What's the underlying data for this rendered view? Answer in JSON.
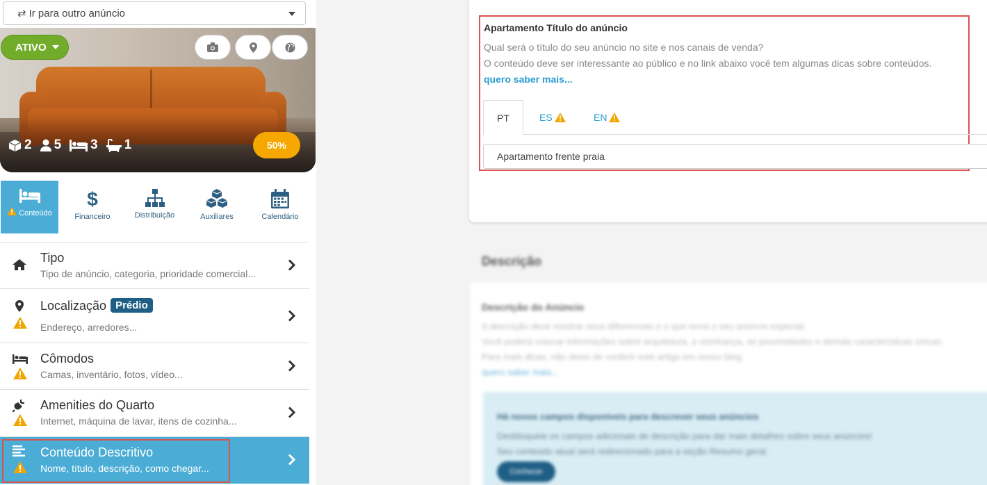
{
  "listing_selector": {
    "label": "Ir para outro anúncio"
  },
  "hero": {
    "status_label": "ATIVO",
    "stats": {
      "cubes": "2",
      "guests": "5",
      "beds": "3",
      "baths": "1"
    },
    "completion": "50%"
  },
  "main_tabs": [
    {
      "label": "Conteúdo",
      "icon": "bed-icon",
      "active": true,
      "warning": true
    },
    {
      "label": "Financeiro",
      "icon": "dollar-icon",
      "active": false
    },
    {
      "label": "Distribuição",
      "icon": "sitemap-icon",
      "active": false
    },
    {
      "label": "Auxiliares",
      "icon": "cubes-icon",
      "active": false
    },
    {
      "label": "Calendário",
      "icon": "calendar-icon",
      "active": false
    }
  ],
  "menu": [
    {
      "title": "Tipo",
      "subtitle": "Tipo de anúncio, categoria, prioridade comercial...",
      "icon": "home-icon",
      "warning": false
    },
    {
      "title": "Localização",
      "badge": "Prédio",
      "subtitle": "Endereço, arredores...",
      "icon": "map-marker-icon",
      "warning": true
    },
    {
      "title": "Cômodos",
      "subtitle": "Camas, inventário, fotos, vídeo...",
      "icon": "bed-icon",
      "warning": true
    },
    {
      "title": "Amenities do Quarto",
      "subtitle": "Internet, máquina de lavar, itens de cozinha...",
      "icon": "plug-icon",
      "warning": true
    },
    {
      "title": "Conteúdo Descritivo",
      "subtitle": "Nome, título, descrição, como chegar...",
      "icon": "align-left-icon",
      "warning": true,
      "active": true
    }
  ],
  "title_field": {
    "label": "Apartamento Título do anúncio",
    "help_line1": "Qual será o título do seu anúncio no site e nos canais de venda?",
    "help_line2": "O conteúdo deve ser interessante ao público e no link abaixo você tem algumas dicas sobre conteúdos.",
    "link": "quero saber mais...",
    "lang_tabs": [
      {
        "label": "PT",
        "active": true,
        "warning": false
      },
      {
        "label": "ES",
        "active": false,
        "warning": true
      },
      {
        "label": "EN",
        "active": false,
        "warning": true
      }
    ],
    "value": "Apartamento frente praia"
  },
  "description_section": {
    "heading": "Descrição",
    "field_label": "Descrição do Anúncio",
    "help_line1": "A descrição deve mostrar seus diferenciais e o que torna o seu anúncio especial.",
    "help_line2": "Você poderá colocar informações sobre arquitetura, a vizinhança, as proximidades e demais características únicas.",
    "help_line3": "Para mais dicas, não deixe de conferir este artigo em nosso blog.",
    "link": "quero saber mais...",
    "info_title": "Há novos campos disponíveis para descrever seus anúncios",
    "info_line1": "Desbloqueie os campos adicionais de descrição para dar mais detalhes sobre seus anúncios!",
    "info_line2": "Seu conteúdo atual será redirecionado para a seção Resumo geral.",
    "info_button": "Conhecer"
  },
  "colors": {
    "accent": "#4badd6",
    "link": "#2d9ed1",
    "warning": "#f0a500",
    "status_green": "#71ad2b",
    "badge": "#1f5f86",
    "highlight": "#d9534f"
  }
}
